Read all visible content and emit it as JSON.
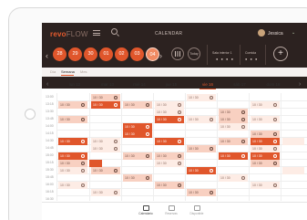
{
  "header": {
    "logo_main": "revo",
    "logo_sub": "FLOW",
    "title": "CALENDAR",
    "user_name": "Jessica"
  },
  "days": [
    "28",
    "29",
    "30",
    "01",
    "02",
    "03",
    "04"
  ],
  "today_button": "Today",
  "filters": [
    {
      "label": "Sala interior 1"
    },
    {
      "label": "Comida"
    }
  ],
  "tabs": [
    "Día",
    "Semana",
    "Mes"
  ],
  "week": {
    "dates": [
      "lun 12",
      "mar 13",
      "mié 14",
      "jue 15",
      "vie 16",
      "sáb 17",
      "dom 18"
    ]
  },
  "times": [
    "13:00",
    "13:15",
    "13:30",
    "13:45",
    "14:00",
    "14:15",
    "14:30",
    "14:45",
    "15:00",
    "15:15",
    "15:30",
    "15:45",
    "16:00",
    "16:15",
    "16:30"
  ],
  "slot_label": "10 / 30",
  "bottom_nav": [
    "Calendario",
    "Reservas",
    "Disponible"
  ],
  "colors": {
    "accent": "#e0562b",
    "header_bg": "#2c2220"
  }
}
